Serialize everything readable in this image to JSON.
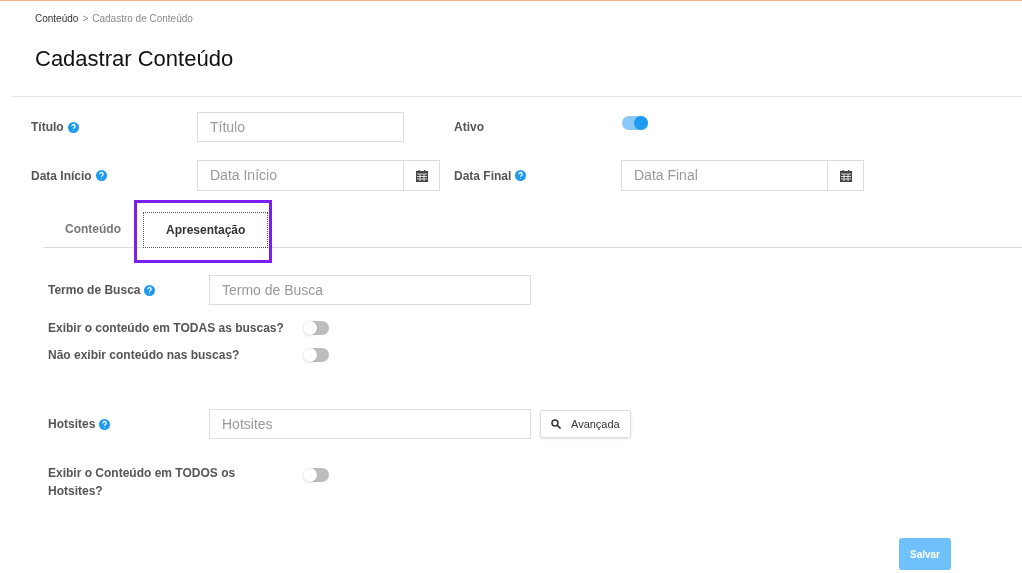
{
  "breadcrumb": {
    "link": "Conteúdo",
    "separator": ">",
    "current": "Cadastro de Conteúdo"
  },
  "title": "Cadastrar Conteúdo",
  "fields": [
    {
      "label": "Título",
      "placeholder": "Título",
      "kind": "text"
    },
    {
      "label": "Data Início",
      "placeholder": "Data Início",
      "kind": "date"
    },
    {
      "label": "Data Final",
      "placeholder": "Data Final",
      "kind": "date"
    }
  ],
  "ativo": {
    "label": "Ativo",
    "on": true
  },
  "tabs": [
    {
      "label": "Conteúdo",
      "selected": false
    },
    {
      "label": "Apresentação",
      "selected": true
    }
  ],
  "search_term": {
    "label": "Termo de Busca",
    "placeholder": "Termo de Busca"
  },
  "search_toggles": [
    {
      "label": "Exibir o conteúdo em TODAS as buscas?",
      "on": false
    },
    {
      "label": "Não exibir conteúdo nas buscas?",
      "on": false
    }
  ],
  "hotsites": {
    "label": "Hotsites",
    "placeholder": "Hotsites",
    "button": "Avançada"
  },
  "hotsites_toggle": {
    "label": "Exibir o Conteúdo em TODOS os Hotsites?",
    "on": false
  },
  "save_button": "Salvar"
}
